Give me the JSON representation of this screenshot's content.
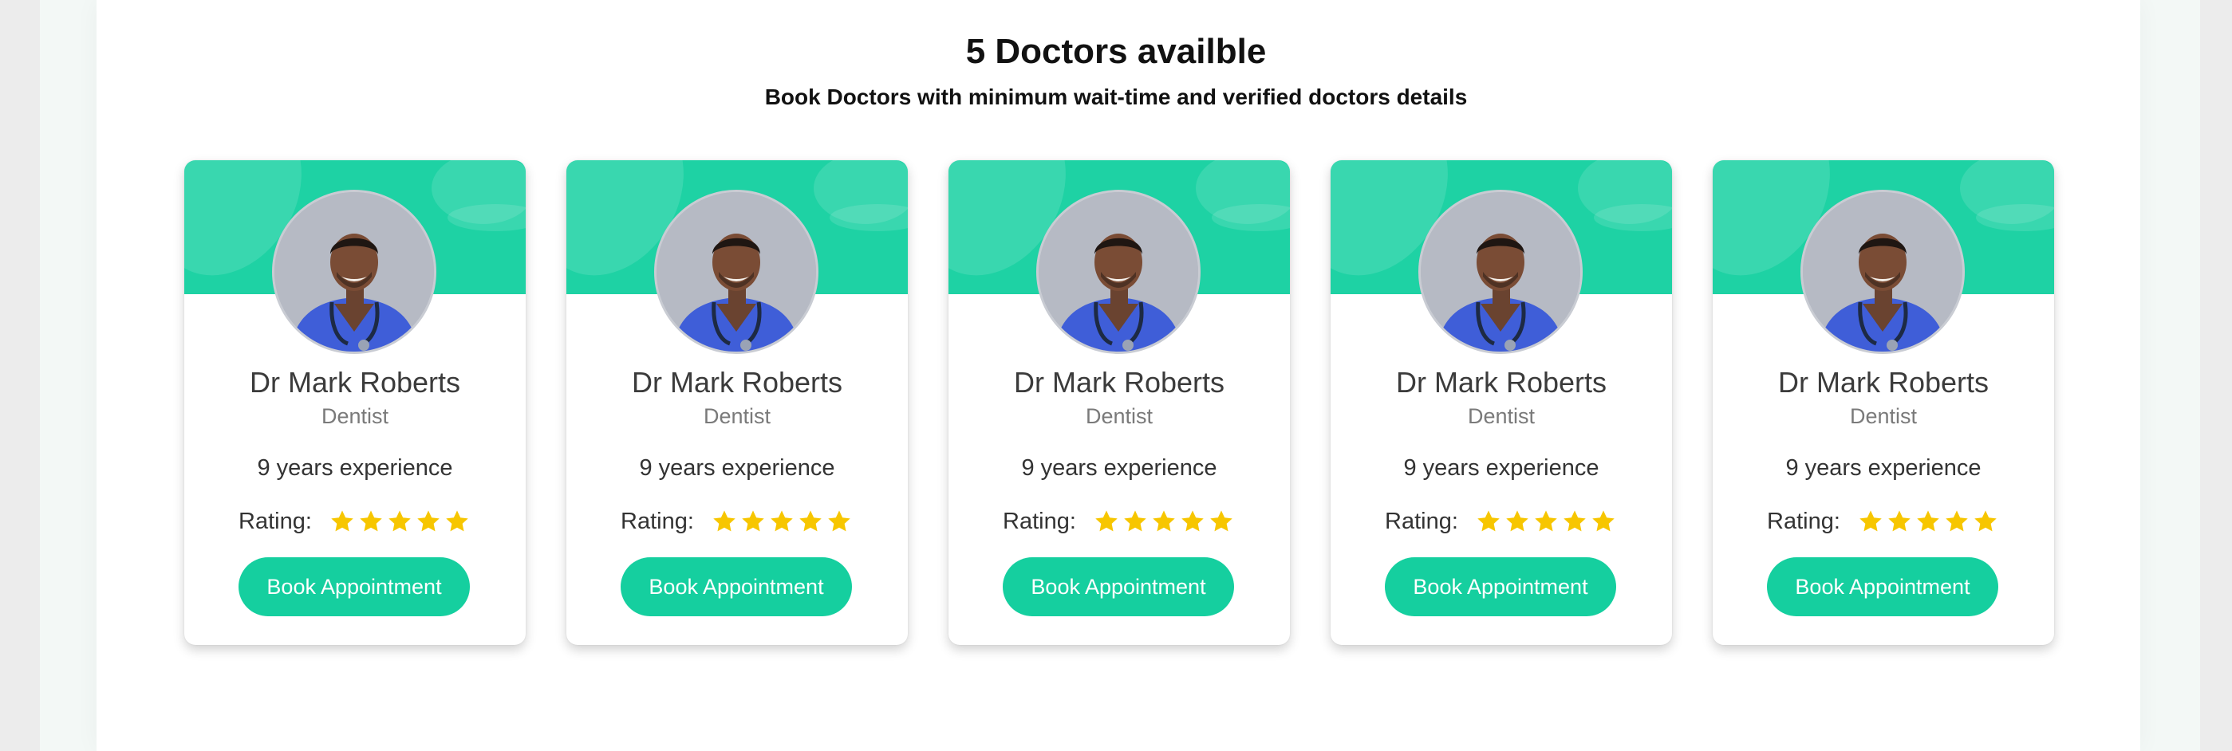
{
  "header": {
    "title": "5 Doctors availble",
    "subtitle": "Book Doctors with minimum wait-time and verified doctors details"
  },
  "colors": {
    "accent": "#1ed2a4",
    "button": "#15cf9f",
    "star": "#f7c600"
  },
  "rating_label": "Rating:",
  "star_icon": "star-icon",
  "doctors": [
    {
      "name": "Dr Mark Roberts",
      "specialty": "Dentist",
      "experience": "9 years experience",
      "rating": 5,
      "button_label": "Book Appointment"
    },
    {
      "name": "Dr Mark Roberts",
      "specialty": "Dentist",
      "experience": "9 years experience",
      "rating": 5,
      "button_label": "Book Appointment"
    },
    {
      "name": "Dr Mark Roberts",
      "specialty": "Dentist",
      "experience": "9 years experience",
      "rating": 5,
      "button_label": "Book Appointment"
    },
    {
      "name": "Dr Mark Roberts",
      "specialty": "Dentist",
      "experience": "9 years experience",
      "rating": 5,
      "button_label": "Book Appointment"
    },
    {
      "name": "Dr Mark Roberts",
      "specialty": "Dentist",
      "experience": "9 years experience",
      "rating": 5,
      "button_label": "Book Appointment"
    }
  ]
}
